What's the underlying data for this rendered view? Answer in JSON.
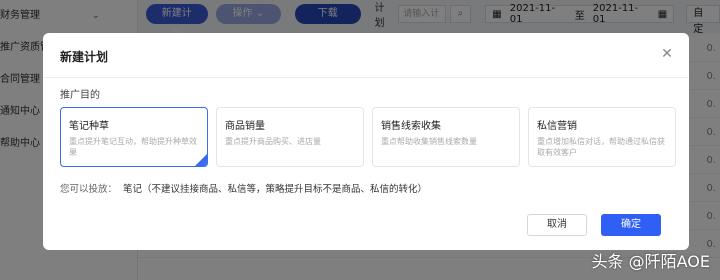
{
  "background": {
    "sidebar": {
      "items": [
        {
          "label": "财务管理",
          "chevron": "⌄"
        },
        {
          "label": "推广资质管理"
        },
        {
          "label": "合同管理"
        },
        {
          "label": "通知中心"
        },
        {
          "label": "帮助中心"
        }
      ]
    },
    "toolbar": {
      "new_plan_label": "新建计划",
      "operate_label": "操作 ⌄",
      "download_label": "下载",
      "filter_label": "计划",
      "input_placeholder": "请输入计",
      "date_start": "2021-11-01",
      "date_sep": "至",
      "date_end": "2021-11-01",
      "custom_label": "自定"
    },
    "row_values": [
      "0.",
      "0.",
      "0.",
      "0.",
      "0.",
      "0.",
      "0.",
      "0."
    ]
  },
  "dialog": {
    "title": "新建计划",
    "section_label": "推广目的",
    "cards": [
      {
        "title": "笔记种草",
        "desc": "重点提升笔记互动，帮助提升种草效果",
        "selected": true
      },
      {
        "title": "商品销量",
        "desc": "重点提升商品购买、进店量",
        "selected": false
      },
      {
        "title": "销售线索收集",
        "desc": "重点帮助收集销售线索数量",
        "selected": false
      },
      {
        "title": "私信营销",
        "desc": "重点增加私信对话，帮助通过私信获取有效客户",
        "selected": false
      }
    ],
    "hint_label": "您可以投放：",
    "hint_value": "笔记（不建议挂接商品、私信等，策略提升目标不是商品、私信的转化）",
    "cancel_label": "取消",
    "confirm_label": "确定"
  },
  "watermark": "头条 @阡陌AOE",
  "colors": {
    "accent": "#2f5ff5",
    "selected_border": "#3b6cf0",
    "overlay": "rgba(0,0,0,0.5)"
  }
}
